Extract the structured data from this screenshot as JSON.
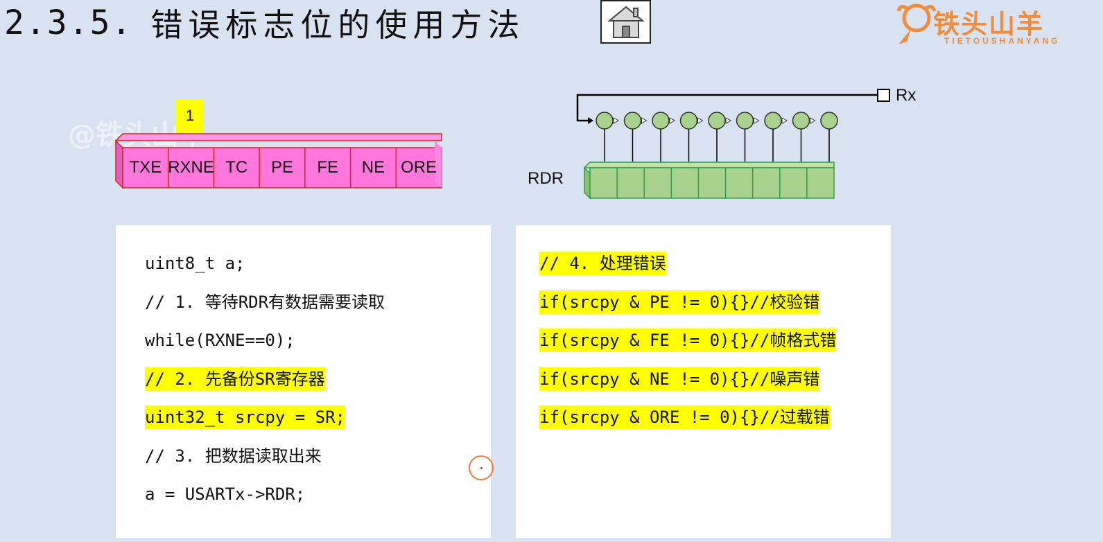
{
  "theme": {
    "background": "#d8e2f0",
    "register_fill": "#ff77dd",
    "register_stroke": "#d3261e",
    "rdr_fill": "#a9d18e",
    "rdr_stroke": "#2ea04e",
    "bit_fill": "#a9d18e",
    "highlight": "#ffff00",
    "logo_color": "#f28b3b"
  },
  "header": {
    "number": "2.3.5.",
    "title": "错误标志位的使用方法",
    "home_icon": "home-icon"
  },
  "logo": {
    "brand": "铁头山羊",
    "subtitle": "TIETOUSHANYANG",
    "icon": "goat-head-icon"
  },
  "watermark": "@铁头山羊",
  "status_register": {
    "flag_value": "1",
    "bits": [
      "TXE",
      "RXNE",
      "TC",
      "PE",
      "FE",
      "NE",
      "ORE"
    ]
  },
  "rdr_diagram": {
    "label": "RDR",
    "input_label": "Rx",
    "bit_count": 9
  },
  "left_code": {
    "lines": [
      {
        "text": "uint8_t a;",
        "highlight": false
      },
      {
        "text": "// 1. 等待RDR有数据需要读取",
        "highlight": false
      },
      {
        "text": "while(RXNE==0);",
        "highlight": false
      },
      {
        "text": "// 2. 先备份SR寄存器",
        "highlight": true
      },
      {
        "text": "uint32_t srcpy = SR;",
        "highlight": true
      },
      {
        "text": "// 3. 把数据读取出来",
        "highlight": false
      },
      {
        "text": "a = USARTx->RDR;",
        "highlight": false
      }
    ]
  },
  "right_code": {
    "lines": [
      {
        "text": "// 4. 处理错误",
        "highlight": true
      },
      {
        "text": "if(srcpy & PE != 0){}//校验错",
        "highlight": true
      },
      {
        "text": "if(srcpy & FE != 0){}//帧格式错",
        "highlight": true
      },
      {
        "text": "if(srcpy & NE != 0){}//噪声错",
        "highlight": true
      },
      {
        "text": "if(srcpy & ORE != 0){}//过载错",
        "highlight": true
      }
    ]
  }
}
